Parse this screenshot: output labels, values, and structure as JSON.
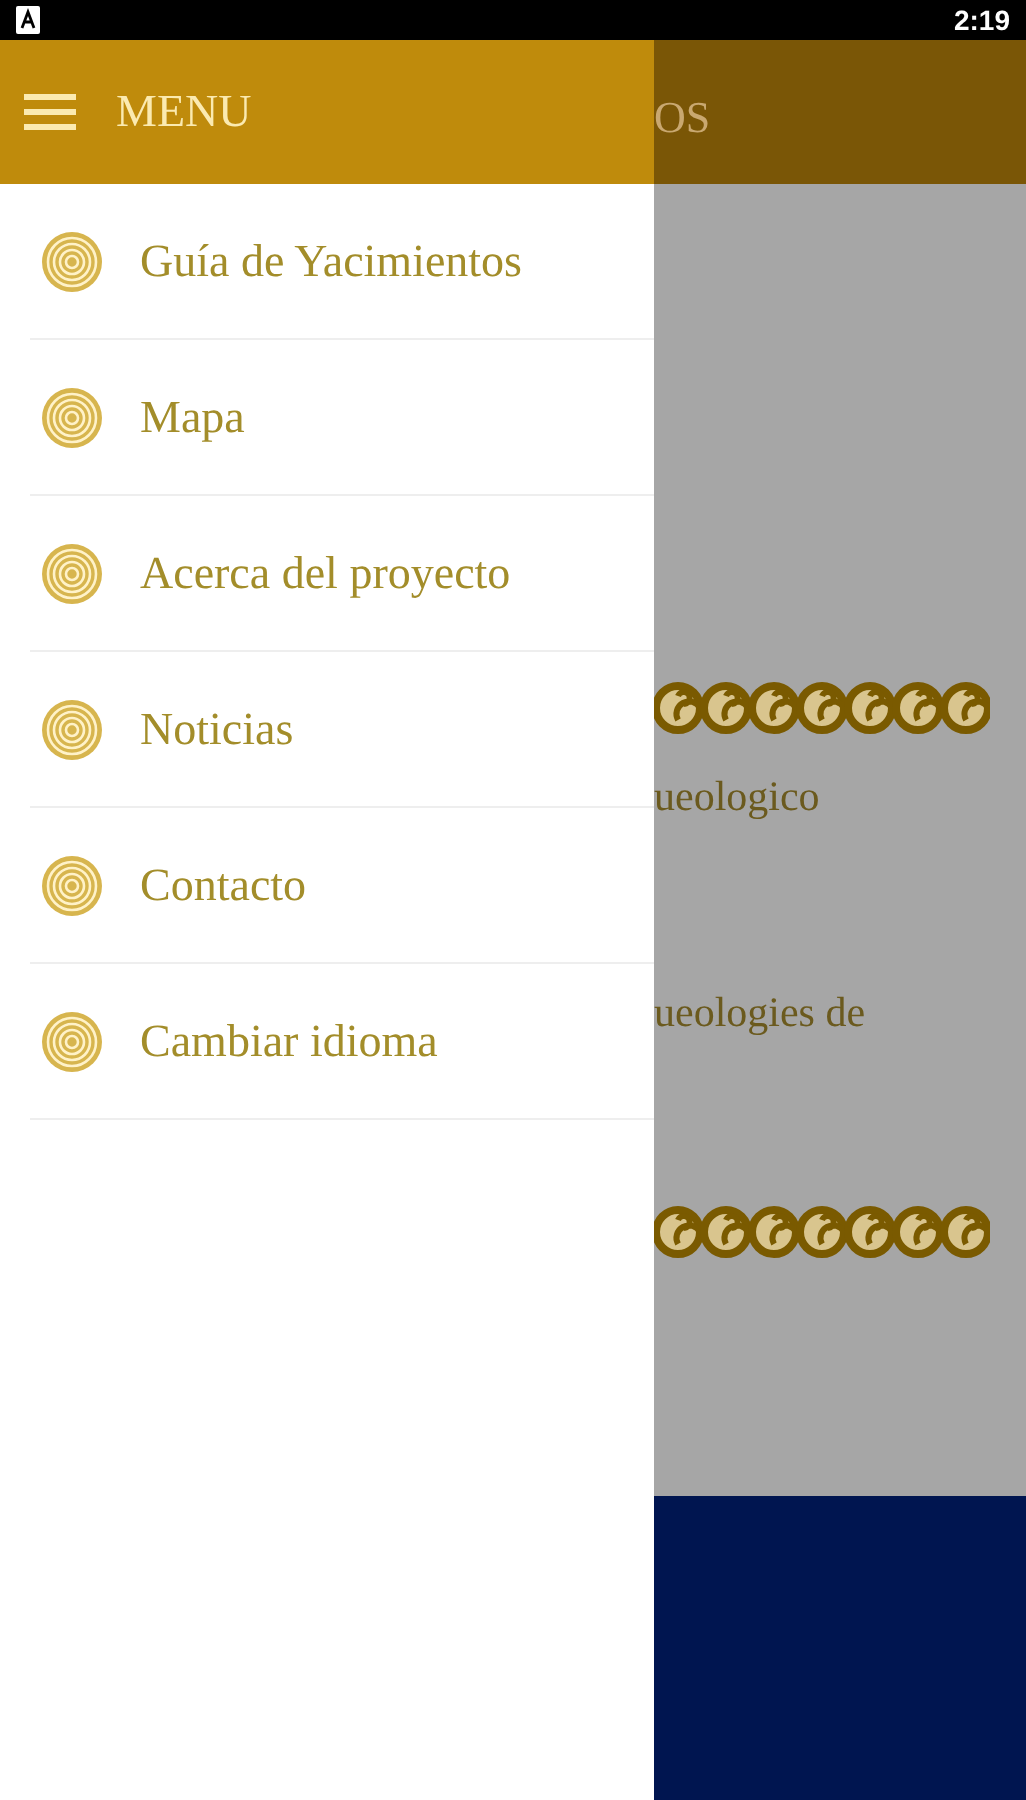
{
  "status_bar": {
    "time": "2:19"
  },
  "menu": {
    "title": "MENU",
    "items": [
      {
        "label": "Guía de Yacimientos"
      },
      {
        "label": "Mapa"
      },
      {
        "label": "Acerca del proyecto"
      },
      {
        "label": "Noticias"
      },
      {
        "label": "Contacto"
      },
      {
        "label": "Cambiar idioma"
      }
    ]
  },
  "background": {
    "header_title": "OS",
    "blocks": [
      {
        "kind": "ornament"
      },
      {
        "kind": "text",
        "text": "ueologico"
      },
      {
        "kind": "text",
        "text": "ueologies de"
      },
      {
        "kind": "ornament"
      }
    ]
  }
}
